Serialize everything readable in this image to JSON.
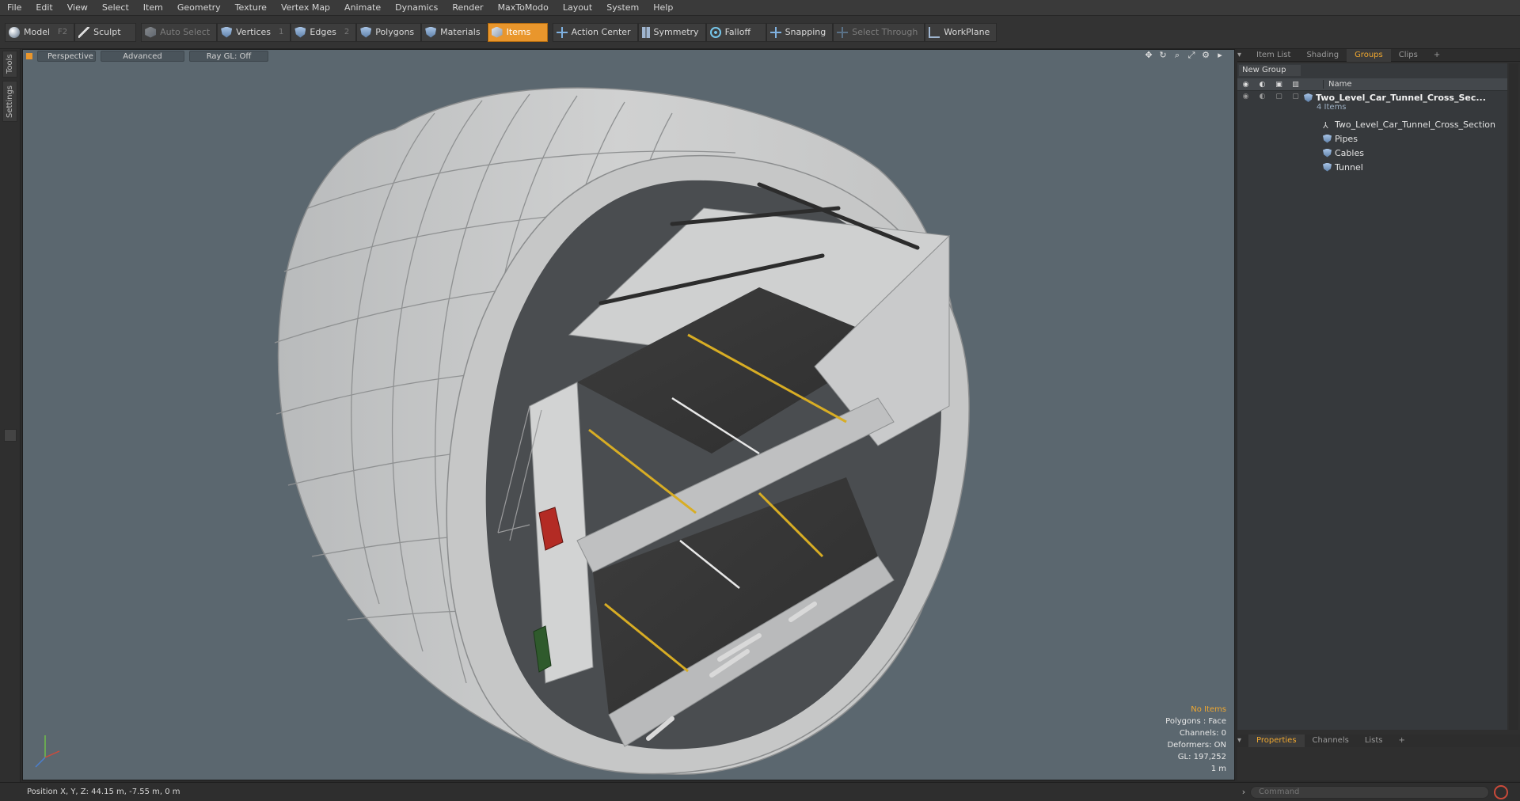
{
  "menu": [
    "File",
    "Edit",
    "View",
    "Select",
    "Item",
    "Geometry",
    "Texture",
    "Vertex Map",
    "Animate",
    "Dynamics",
    "Render",
    "MaxToModo",
    "Layout",
    "System",
    "Help"
  ],
  "toolbar": {
    "model": "Model",
    "model_key": "F2",
    "sculpt": "Sculpt",
    "auto_select": "Auto Select",
    "vertices": "Vertices",
    "vertices_key": "1",
    "edges": "Edges",
    "edges_key": "2",
    "polygons": "Polygons",
    "materials": "Materials",
    "items": "Items",
    "action_center": "Action Center",
    "symmetry": "Symmetry",
    "falloff": "Falloff",
    "snapping": "Snapping",
    "select_through": "Select Through",
    "workplane": "WorkPlane"
  },
  "left_tabs": [
    "Tools",
    "Settings"
  ],
  "viewport": {
    "view": "Perspective",
    "shading": "Advanced",
    "raygl": "Ray GL: Off",
    "info": {
      "selection": "No Items",
      "polygons": "Polygons : Face",
      "channels": "Channels: 0",
      "deformers": "Deformers: ON",
      "gl": "GL: 197,252",
      "scale": "1 m"
    }
  },
  "right_panel": {
    "tabs": [
      "Item List",
      "Shading",
      "Groups",
      "Clips",
      "+"
    ],
    "active_tab": "Groups",
    "new_group": "New Group",
    "name_col": "Name",
    "root": {
      "label": "Two_Level_Car_Tunnel_Cross_Sec...",
      "sub": "4 Items"
    },
    "children": [
      "Two_Level_Car_Tunnel_Cross_Section",
      "Pipes",
      "Cables",
      "Tunnel"
    ],
    "bottom_tabs": [
      "Properties",
      "Channels",
      "Lists",
      "+"
    ]
  },
  "status": {
    "position": "Position X, Y, Z:  44.15 m, -7.55 m, 0 m"
  },
  "command": {
    "placeholder": "Command"
  },
  "colors": {
    "accent": "#e9962c",
    "viewport_bg": "#5b676f",
    "road_line": "#e0b020"
  }
}
